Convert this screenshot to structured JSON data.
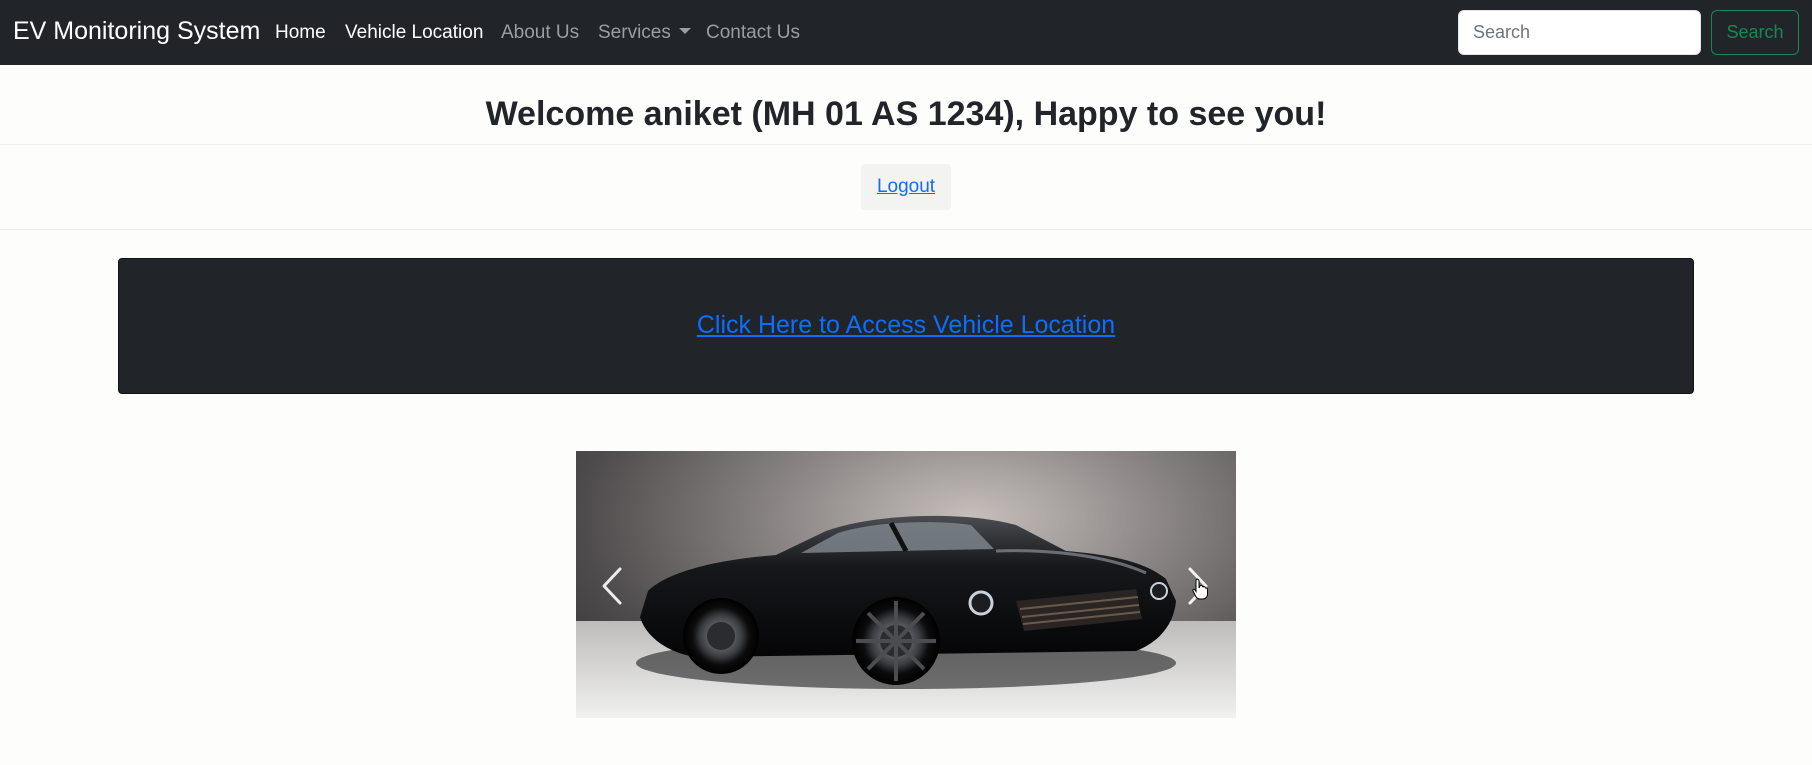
{
  "navbar": {
    "brand": "EV Monitoring System",
    "links": {
      "home": "Home",
      "vehicle_location": "Vehicle Location",
      "about": "About Us",
      "services": "Services",
      "contact": "Contact Us"
    },
    "search": {
      "placeholder": "Search",
      "button": "Search"
    }
  },
  "main": {
    "welcome": "Welcome aniket (MH 01 AS 1234), Happy to see you!",
    "logout": "Logout",
    "access_link": "Click Here to Access Vehicle Location"
  },
  "carousel": {
    "slide_subject": "black muscle car",
    "prev_icon": "chevron-left-icon",
    "next_icon": "chevron-right-icon"
  },
  "colors": {
    "navbar_bg": "#212529",
    "link_blue": "#0d6efd",
    "search_green": "#198754"
  }
}
